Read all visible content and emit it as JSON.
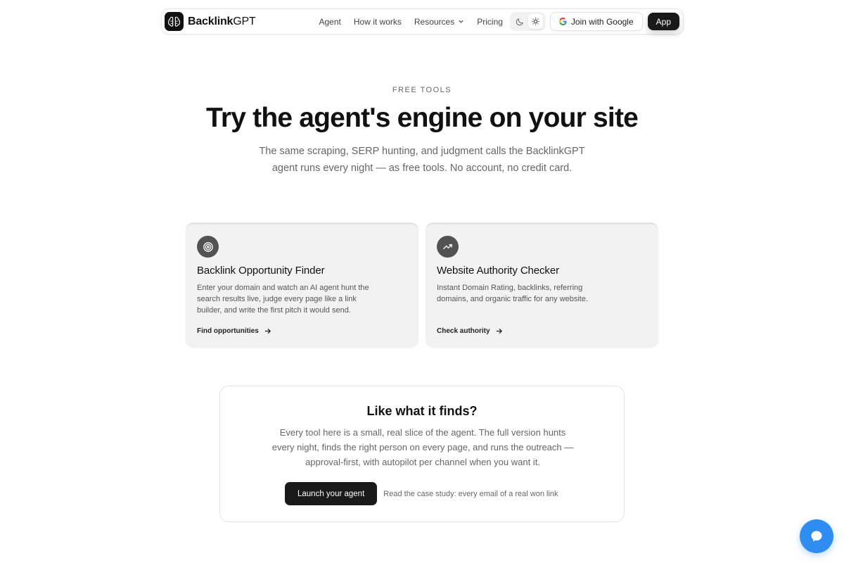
{
  "nav": {
    "brand_bold": "Backlink",
    "brand_rest": "GPT",
    "links": [
      "Agent",
      "How it works",
      "Resources",
      "Pricing"
    ],
    "join_label": "Join with Google",
    "app_label": "App"
  },
  "hero": {
    "eyebrow": "FREE TOOLS",
    "title": "Try the agent's engine on your site",
    "subtitle": "The same scraping, SERP hunting, and judgment calls the BacklinkGPT agent runs every night — as free tools. No account, no credit card."
  },
  "cards": [
    {
      "icon": "target-icon",
      "title": "Backlink Opportunity Finder",
      "description": "Enter your domain and watch an AI agent hunt the search results live, judge every page like a link builder, and write the first pitch it would send.",
      "link": "Find opportunities"
    },
    {
      "icon": "trending-up-icon",
      "title": "Website Authority Checker",
      "description": "Instant Domain Rating, backlinks, referring domains, and organic traffic for any website.",
      "link": "Check authority"
    }
  ],
  "cta": {
    "title": "Like what it finds?",
    "text": "Every tool here is a small, real slice of the agent. The full version hunts every night, finds the right person on every page, and runs the outreach — approval-first, with autopilot per channel when you want it.",
    "button": "Launch your agent",
    "case_link": "Read the case study: every email of a real won link"
  },
  "colors": {
    "accent_chat": "#2f8cf0",
    "dark": "#1a1a1a",
    "card_bg": "#f2f2f2"
  }
}
